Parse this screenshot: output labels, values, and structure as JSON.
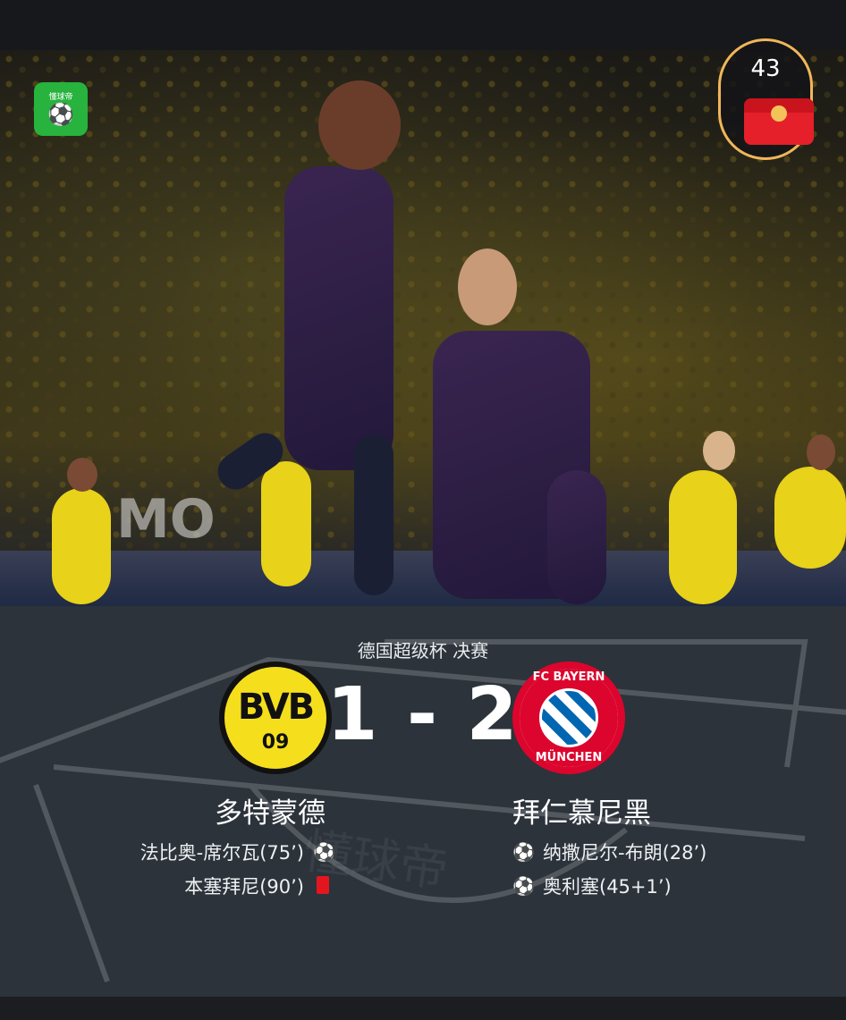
{
  "app": {
    "logo_label": "懂球帝",
    "logo_icon": "soccer-ball-icon"
  },
  "red_packet": {
    "count": "43",
    "icon": "red-envelope-icon"
  },
  "photo": {
    "board_text": "MO"
  },
  "match": {
    "competition": "德国超级杯 决赛",
    "score": "1 - 2",
    "home": {
      "name": "多特蒙德",
      "crest_text": "BVB",
      "crest_sub": "09",
      "events": [
        {
          "text": "法比奥-席尔瓦(75’)",
          "type": "goal",
          "icon": "soccer-ball-icon"
        },
        {
          "text": "本塞拜尼(90’)",
          "type": "red_card",
          "icon": "red-card-icon"
        }
      ]
    },
    "away": {
      "name": "拜仁慕尼黑",
      "crest_top": "FC BAYERN",
      "crest_bottom": "MÜNCHEN",
      "events": [
        {
          "text": "纳撒尼尔-布朗(28’)",
          "type": "goal",
          "icon": "soccer-ball-icon"
        },
        {
          "text": "奥利塞(45+1’)",
          "type": "goal",
          "icon": "soccer-ball-icon"
        }
      ]
    }
  },
  "colors": {
    "panel_bg": "#2c333b",
    "bvb_yellow": "#f5df1d",
    "bayern_red": "#dc052d",
    "red_card": "#e3161f",
    "app_green": "#27b33d"
  }
}
